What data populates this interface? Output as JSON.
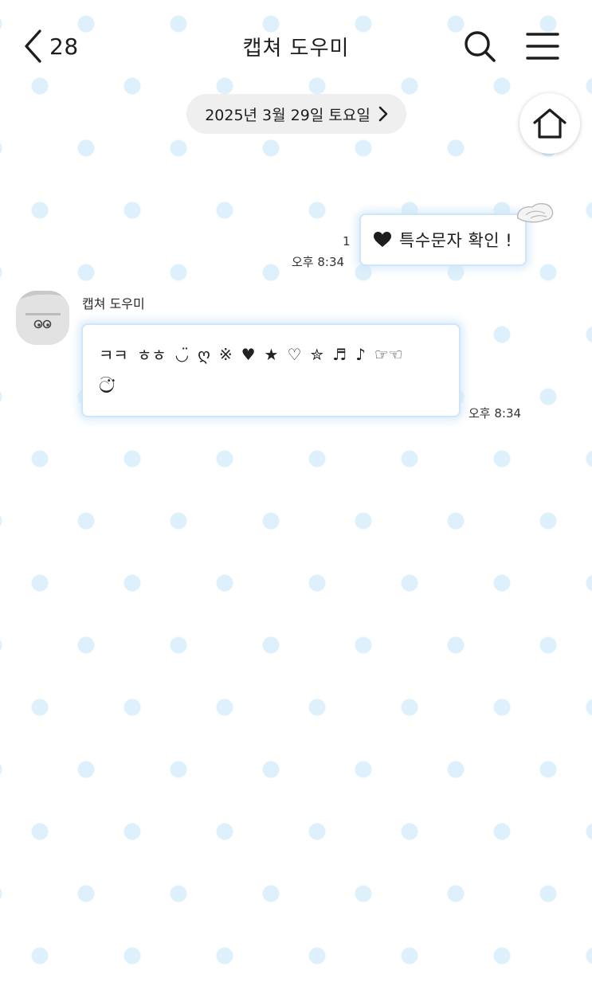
{
  "header": {
    "back_count": "28",
    "title": "캡쳐 도우미",
    "back_icon": "chevron-left-icon",
    "search_icon": "search-icon",
    "menu_icon": "menu-icon"
  },
  "date_divider": {
    "label": "2025년 3월 29일 토요일",
    "icon": "chevron-right-icon"
  },
  "home_button": {
    "icon": "home-icon"
  },
  "messages": [
    {
      "direction": "sent",
      "text": "특수문자 확인 !",
      "leading_icon": "heart-icon",
      "read_count": "1",
      "time": "오후 8:34",
      "decoration": "wing-icon"
    },
    {
      "direction": "received",
      "sender": "캡쳐 도우미",
      "line1": [
        "ㅋㅋ",
        "ㅎㅎ",
        "◡̈",
        "ღ",
        "※",
        "♥",
        "★",
        "♡",
        "✮",
        "♬",
        "♪",
        "☞☜"
      ],
      "line2": "ට̈",
      "time": "오후 8:34"
    }
  ],
  "colors": {
    "background": "#ffffff",
    "dots": "#ddf0fb",
    "bubble_border": "#cfe6f8",
    "date_chip": "#efefef",
    "text": "#1d1d1d"
  }
}
